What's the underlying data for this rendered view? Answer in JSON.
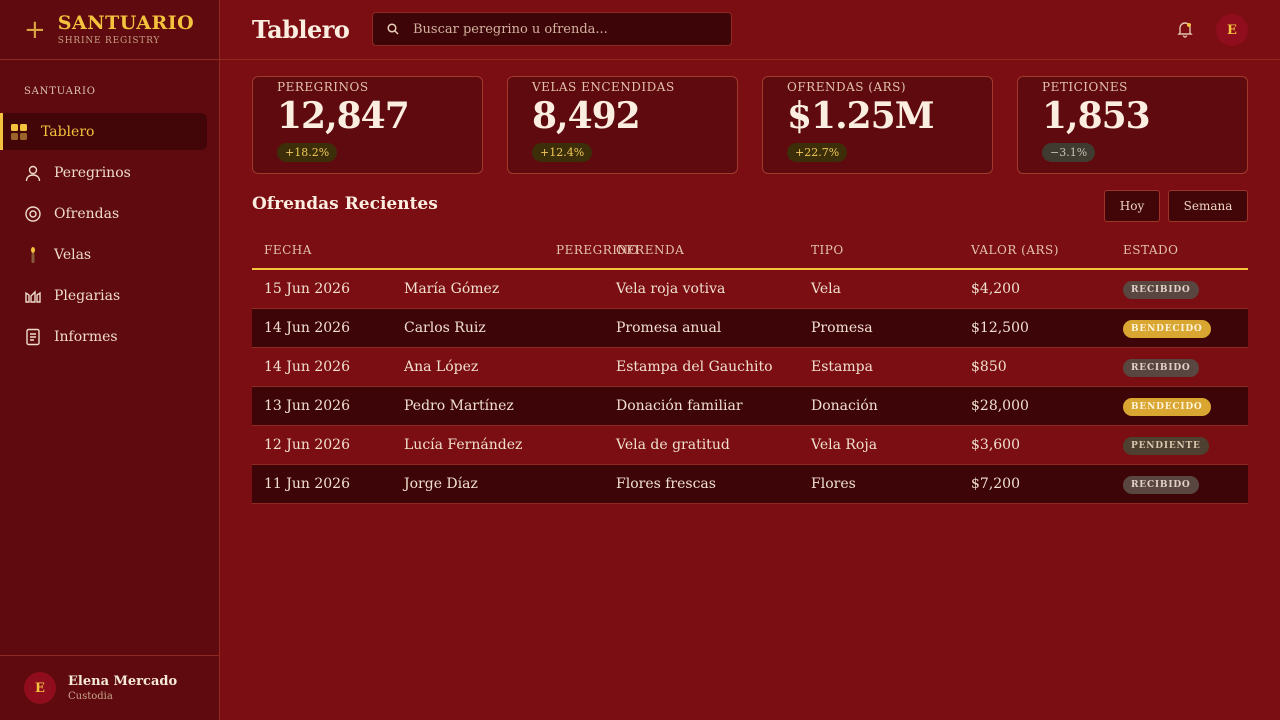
{
  "app": {
    "brand_name": "SANTUARIO",
    "brand_sub": "SHRINE REGISTRY",
    "page_title": "Tablero"
  },
  "search": {
    "placeholder": "Buscar peregrino u ofrenda..."
  },
  "header": {
    "avatar_initial": "E"
  },
  "sidebar": {
    "section_label": "SANTUARIO",
    "items": [
      {
        "label": "Tablero",
        "icon": "grid-icon",
        "active": true
      },
      {
        "label": "Peregrinos",
        "icon": "person-icon"
      },
      {
        "label": "Ofrendas",
        "icon": "target-icon"
      },
      {
        "label": "Velas",
        "icon": "candle-icon"
      },
      {
        "label": "Plegarias",
        "icon": "hands-icon"
      },
      {
        "label": "Informes",
        "icon": "report-icon"
      }
    ]
  },
  "user": {
    "initial": "E",
    "name": "Elena Mercado",
    "role": "Custodia"
  },
  "stats": [
    {
      "label": "PEREGRINOS",
      "value": "12,847",
      "delta": "+18.2%",
      "trend": "up"
    },
    {
      "label": "VELAS ENCENDIDAS",
      "value": "8,492",
      "delta": "+12.4%",
      "trend": "up"
    },
    {
      "label": "OFRENDAS (ARS)",
      "value": "$1.25M",
      "delta": "+22.7%",
      "trend": "up"
    },
    {
      "label": "PETICIONES",
      "value": "1,853",
      "delta": "−3.1%",
      "trend": "down"
    }
  ],
  "section": {
    "title": "Ofrendas Recientes",
    "filters": [
      "Hoy",
      "Semana"
    ]
  },
  "table": {
    "columns": [
      "FECHA",
      "PEREGRINO",
      "OFRENDA",
      "TIPO",
      "VALOR (ARS)",
      "ESTADO"
    ],
    "rows": [
      [
        "15 Jun 2026",
        "María Gómez",
        "Vela roja votiva",
        "Vela",
        "$4,200",
        "RECIBIDO"
      ],
      [
        "14 Jun 2026",
        "Carlos Ruiz",
        "Promesa anual",
        "Promesa",
        "$12,500",
        "BENDECIDO"
      ],
      [
        "14 Jun 2026",
        "Ana López",
        "Estampa del Gauchito",
        "Estampa",
        "$850",
        "RECIBIDO"
      ],
      [
        "13 Jun 2026",
        "Pedro Martínez",
        "Donación familiar",
        "Donación",
        "$28,000",
        "BENDECIDO"
      ],
      [
        "12 Jun 2026",
        "Lucía Fernández",
        "Vela de gratitud",
        "Vela Roja",
        "$3,600",
        "PENDIENTE"
      ],
      [
        "11 Jun 2026",
        "Jorge Díaz",
        "Flores frescas",
        "Flores",
        "$7,200",
        "RECIBIDO"
      ]
    ]
  },
  "colors": {
    "background": "#7b0e12",
    "sidebar": "#5e0a0e",
    "accent": "#f5c23d",
    "badge_bendecido": "#d8a631",
    "badge_recibido": "#5a4640",
    "badge_pendiente": "#4d4030"
  }
}
